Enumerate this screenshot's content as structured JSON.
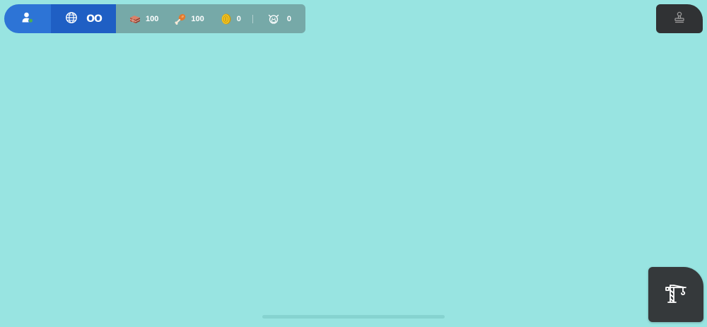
{
  "hud": {
    "profile": {
      "icon": "user-online-icon",
      "status_color": "#4caf50"
    },
    "world": {
      "icon": "globe-icon",
      "value": "OO"
    },
    "resources": [
      {
        "name": "bricks",
        "icon": "bricks-icon",
        "value": "100"
      },
      {
        "name": "food",
        "icon": "drumstick-icon",
        "value": "100"
      },
      {
        "name": "coins",
        "icon": "coin-icon",
        "value": "0"
      },
      {
        "name": "cows",
        "icon": "cow-icon",
        "value": "0"
      }
    ]
  },
  "top_right_button": {
    "icon": "stamp-icon"
  },
  "build_button": {
    "icon": "crane-icon"
  },
  "colors": {
    "ground": "#98e4e1",
    "profile_bg": "#2d74d6",
    "world_bg": "#1f5fc4",
    "resources_bg": "#76a9a8",
    "button_bg": "#35393b"
  }
}
